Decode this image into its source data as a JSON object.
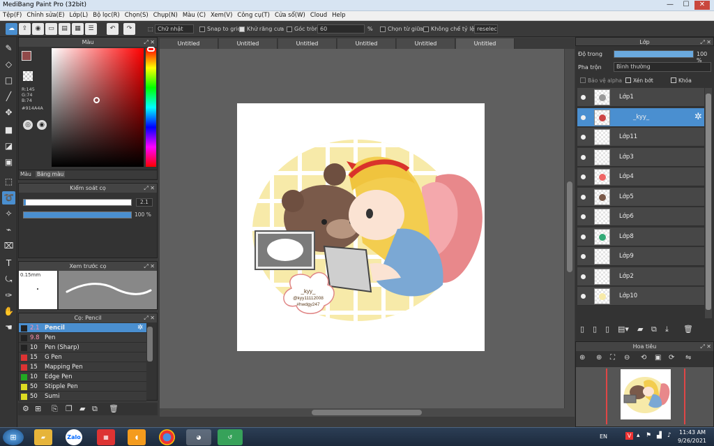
{
  "window": {
    "title": "MediBang Paint Pro (32bit)",
    "min": "—",
    "max": "☐",
    "close": "✕"
  },
  "menu": [
    "Tệp(F)",
    "Chỉnh sửa(E)",
    "Lớp(L)",
    "Bộ lọc(R)",
    "Chọn(S)",
    "Chụp(N)",
    "Màu (C)",
    "Xem(V)",
    "Công cụ(T)",
    "Cửa sổ(W)",
    "Cloud",
    "Help"
  ],
  "toolbar": {
    "aa_mode": "Chữ nhật",
    "snap": "Snap to grid",
    "antialias": "Khử răng cưa",
    "corner": "Góc tròn",
    "corner_value": "60",
    "pct": "%",
    "center": "Chọn từ giữa",
    "ratio": "Không chế tỷ lệ",
    "reset": "reselec"
  },
  "color_panel": {
    "title": "Màu",
    "r": "R:145",
    "g": "G:74",
    "b": "B:74",
    "hex": "#914A4A",
    "tab1": "Màu",
    "tab2": "Bảng màu",
    "main_color": "#914a4a",
    "hue_color": "#ff0000"
  },
  "brush_control": {
    "title": "Kiểm soát cọ",
    "size": "2.1",
    "opacity": "100 %"
  },
  "brush_preview": {
    "title": "Xem trước cọ",
    "size": "0.15mm"
  },
  "brushes": {
    "title": "Cọ: Pencil",
    "items": [
      {
        "size": "2.1",
        "name": "Pencil",
        "color": "#222222"
      },
      {
        "size": "9.8",
        "name": "Pen",
        "color": "#222222"
      },
      {
        "size": "10",
        "name": "Pen (Sharp)",
        "color": "#222222"
      },
      {
        "size": "15",
        "name": "G Pen",
        "color": "#d33"
      },
      {
        "size": "15",
        "name": "Mapping Pen",
        "color": "#d33"
      },
      {
        "size": "10",
        "name": "Edge Pen",
        "color": "#2a2"
      },
      {
        "size": "50",
        "name": "Stipple Pen",
        "color": "#dd2"
      },
      {
        "size": "50",
        "name": "Sumi",
        "color": "#dd2"
      }
    ]
  },
  "tabs": [
    "Untitled",
    "Untitled",
    "Untitled",
    "Untitled",
    "Untitled",
    "Untitled"
  ],
  "layers_panel": {
    "title": "Lớp",
    "opacity_label": "Độ trong",
    "opacity_value": "100 %",
    "blend_label": "Pha trộn",
    "blend_value": "Bình thường",
    "protect_alpha": "Bảo vệ alpha",
    "clipping": "Xén bớt",
    "lock": "Khóa",
    "layers": [
      "Lớp1",
      "_kyy_",
      "Lớp11",
      "Lớp3",
      "Lớp4",
      "Lớp5",
      "Lớp6",
      "Lớp8",
      "Lớp9",
      "Lớp2",
      "Lớp10"
    ]
  },
  "navigator": {
    "title": "Hoa tiêu"
  },
  "artwork": {
    "watermark_line1": "_kyy_",
    "watermark_line2": "@kyy11112008",
    "watermark_line3": "#hwdgy247"
  },
  "taskbar": {
    "lang": "EN",
    "time": "11:43 AM",
    "date": "9/26/2021",
    "zalo": "Zalo"
  }
}
